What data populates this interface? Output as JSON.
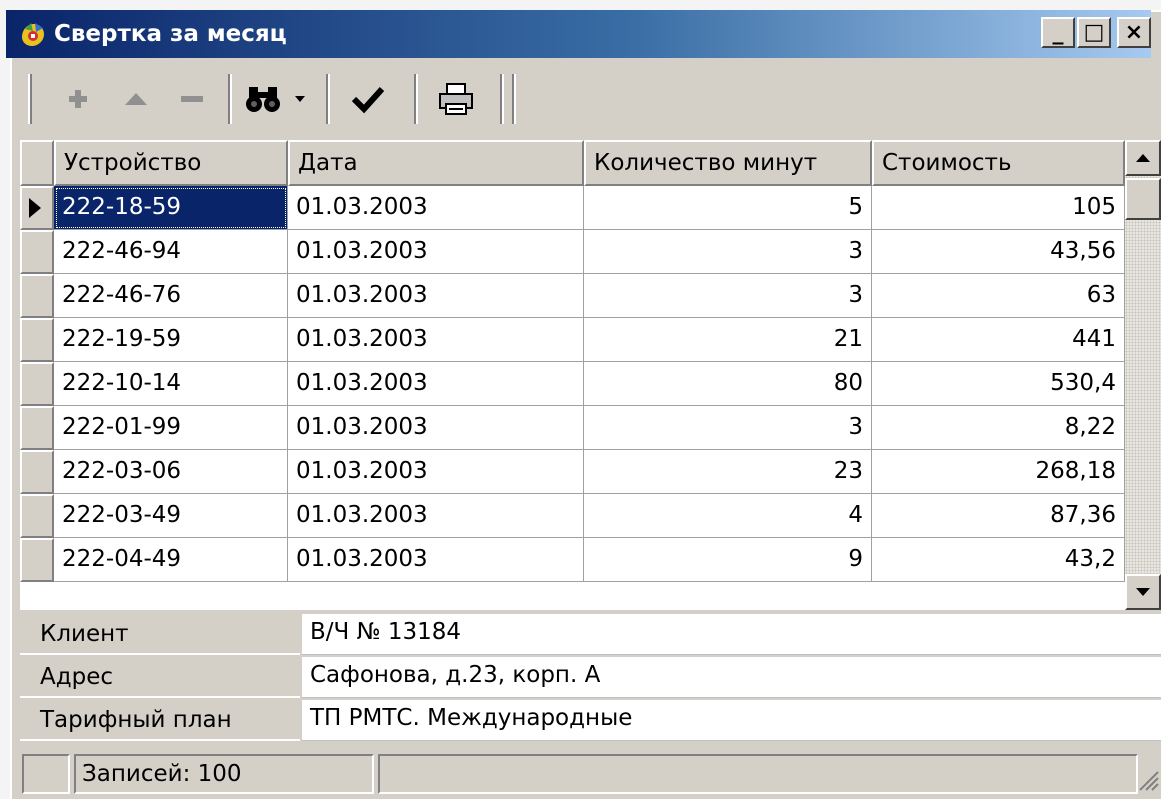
{
  "window": {
    "title": "Свертка за месяц",
    "controls": {
      "minimize": "_",
      "maximize": "□",
      "close": "×"
    }
  },
  "toolbar": {
    "icons": [
      "add-icon",
      "up-icon",
      "delete-icon",
      "binoculars-icon",
      "dropdown-arrow-icon",
      "checkmark-icon",
      "printer-icon"
    ]
  },
  "grid": {
    "columns": [
      "Устройство",
      "Дата",
      "Количество минут",
      "Стоимость"
    ],
    "rows": [
      [
        "222-18-59",
        "01.03.2003",
        "5",
        "105"
      ],
      [
        "222-46-94",
        "01.03.2003",
        "3",
        "43,56"
      ],
      [
        "222-46-76",
        "01.03.2003",
        "3",
        "63"
      ],
      [
        "222-19-59",
        "01.03.2003",
        "21",
        "441"
      ],
      [
        "222-10-14",
        "01.03.2003",
        "80",
        "530,4"
      ],
      [
        "222-01-99",
        "01.03.2003",
        "3",
        "8,22"
      ],
      [
        "222-03-06",
        "01.03.2003",
        "23",
        "268,18"
      ],
      [
        "222-03-49",
        "01.03.2003",
        "4",
        "87,36"
      ],
      [
        "222-04-49",
        "01.03.2003",
        "9",
        "43,2"
      ]
    ],
    "selected_row": 0
  },
  "details": [
    {
      "label": "Клиент",
      "value": "В/Ч № 13184"
    },
    {
      "label": "Адрес",
      "value": "Сафонова, д.23, корп. А"
    },
    {
      "label": "Тарифный план",
      "value": "ТП РМТС. Международные"
    }
  ],
  "status": {
    "records": "Записей: 100"
  },
  "colors": {
    "title_start": "#0a246a",
    "title_end": "#a6caf0",
    "face": "#d4d0c8",
    "selection": "#0a246a"
  }
}
